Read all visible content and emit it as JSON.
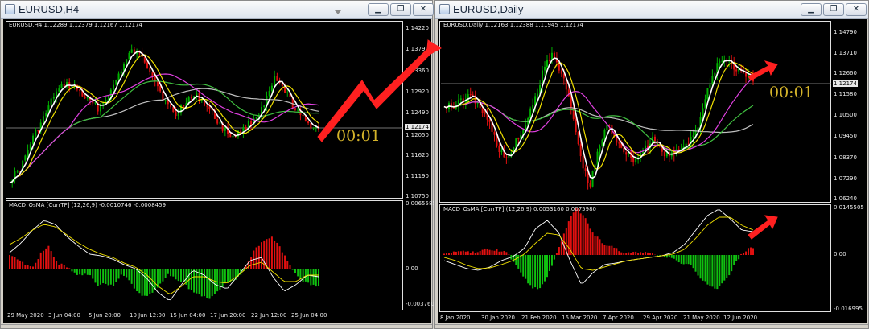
{
  "windows": {
    "left": {
      "title": "EURUSD,H4",
      "info_line": "EURUSD,H4  1.12289 1.12379 1.12167 1.12174",
      "price_ticks": [
        "1.14220",
        "1.13790",
        "1.13360",
        "1.12920",
        "1.12490",
        "1.12050",
        "1.11620",
        "1.11190",
        "1.10750"
      ],
      "current_price": "1.12174",
      "timer": "00:01",
      "macd_label": "MACD_OsMA [CurrTF] (12,26,9) -0.0010746 -0.0008459",
      "macd_ticks": [
        "0.0065585",
        "0.00",
        "-0.003760"
      ],
      "time_ticks": [
        "29 May 2020",
        "3 Jun 04:00",
        "5 Jun 20:00",
        "10 Jun 12:00",
        "15 Jun 04:00",
        "17 Jun 20:00",
        "22 Jun 12:00",
        "25 Jun 04:00"
      ]
    },
    "right": {
      "title": "EURUSD,Daily",
      "info_line": "EURUSD,Daily  1.12163 1.12388 1.11945 1.12174",
      "price_ticks": [
        "1.14790",
        "1.13710",
        "1.12660",
        "1.11580",
        "1.10500",
        "1.09450",
        "1.08370",
        "1.07290",
        "1.06240"
      ],
      "current_price": "1.12174",
      "timer": "00:01",
      "macd_label": "MACD_OsMA [CurrTF] (12,26,9) 0.0053160 0.0075980",
      "macd_ticks": [
        "0.0145505",
        "0.00",
        "-0.016995"
      ],
      "time_ticks": [
        "8 Jan 2020",
        "30 Jan 2020",
        "21 Feb 2020",
        "16 Mar 2020",
        "7 Apr 2020",
        "29 Apr 2020",
        "21 May 2020",
        "12 Jun 2020"
      ]
    }
  },
  "buttons": {
    "minimize": "▁",
    "restore": "❐",
    "close": "✕"
  },
  "colors": {
    "bull": "#00b000",
    "bear": "#e01010",
    "ma_white": "#ffffff",
    "ma_yellow": "#f0e000",
    "ma_magenta": "#e040e0",
    "ma_green": "#40c040",
    "ma_gray": "#c0c0c0",
    "hist_pos": "#e01010",
    "hist_neg": "#10c010",
    "timer": "#d4b32a",
    "annotation": "#ff2020"
  }
}
